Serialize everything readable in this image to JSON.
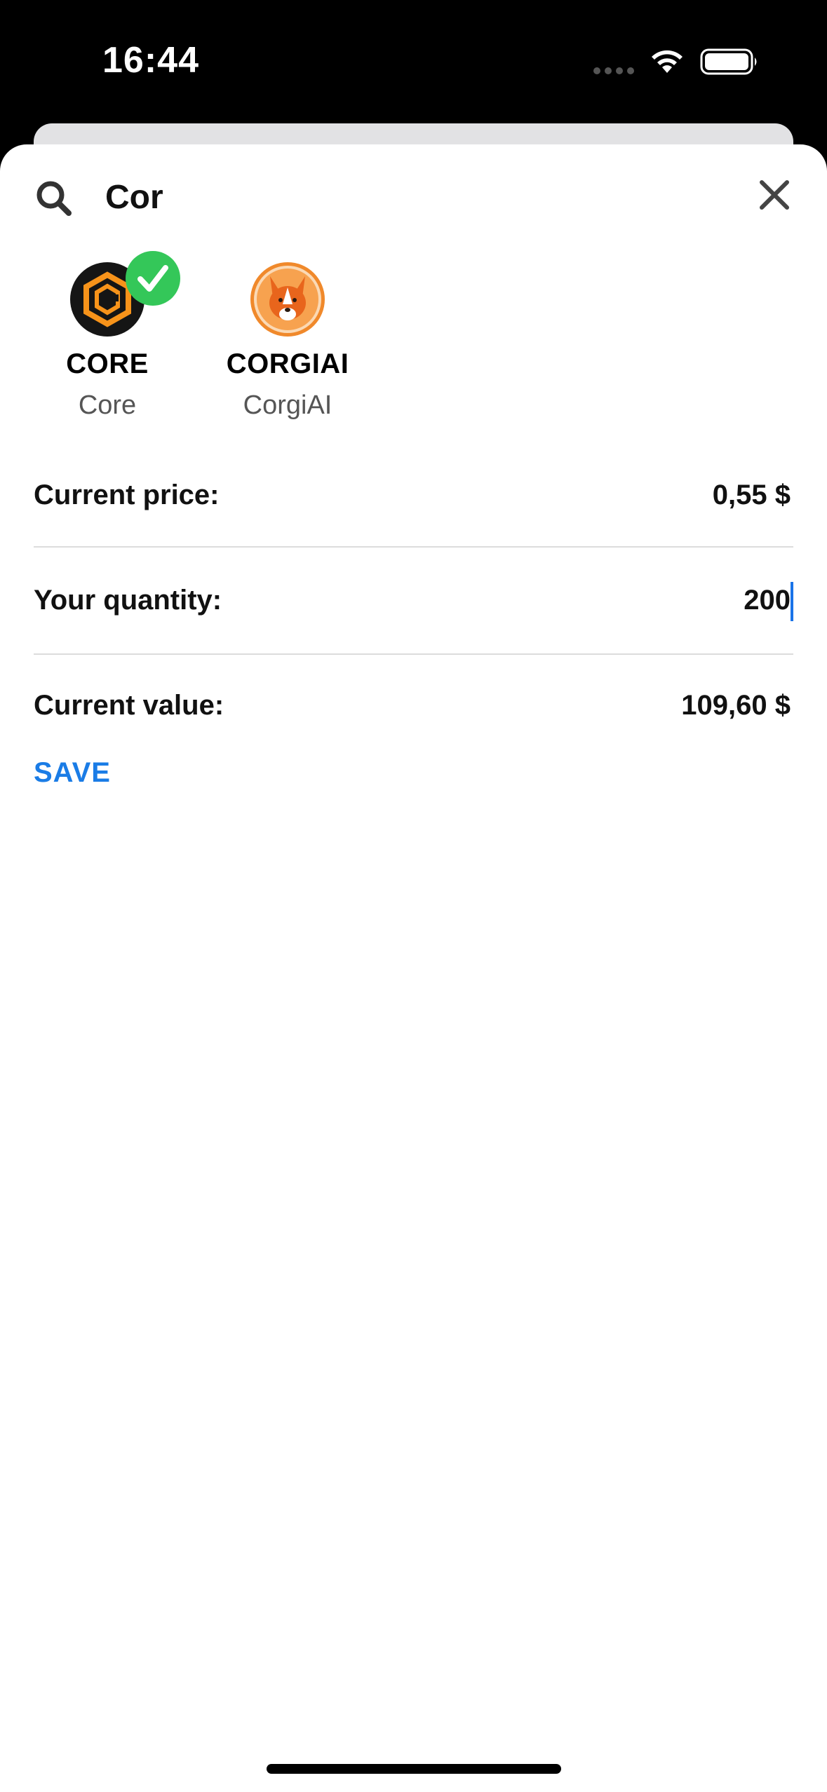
{
  "status_bar": {
    "time": "16:44"
  },
  "search": {
    "value": "Cor",
    "icon": "search-icon",
    "close_icon": "close-icon"
  },
  "results": [
    {
      "symbol": "CORE",
      "name": "Core",
      "selected": true,
      "icon": "core-logo-icon"
    },
    {
      "symbol": "CORGIAI",
      "name": "CorgiAI",
      "selected": false,
      "icon": "corgiai-logo-icon"
    }
  ],
  "form": {
    "current_price_label": "Current price:",
    "current_price_value": "0,55 $",
    "quantity_label": "Your quantity:",
    "quantity_value": "200",
    "current_value_label": "Current value:",
    "current_value_value": "109,60 $",
    "save_label": "SAVE"
  },
  "colors": {
    "accent": "#1a7ce6",
    "check_green": "#34c759",
    "core_orange": "#f7931a",
    "corgi_orange": "#f0892b"
  }
}
